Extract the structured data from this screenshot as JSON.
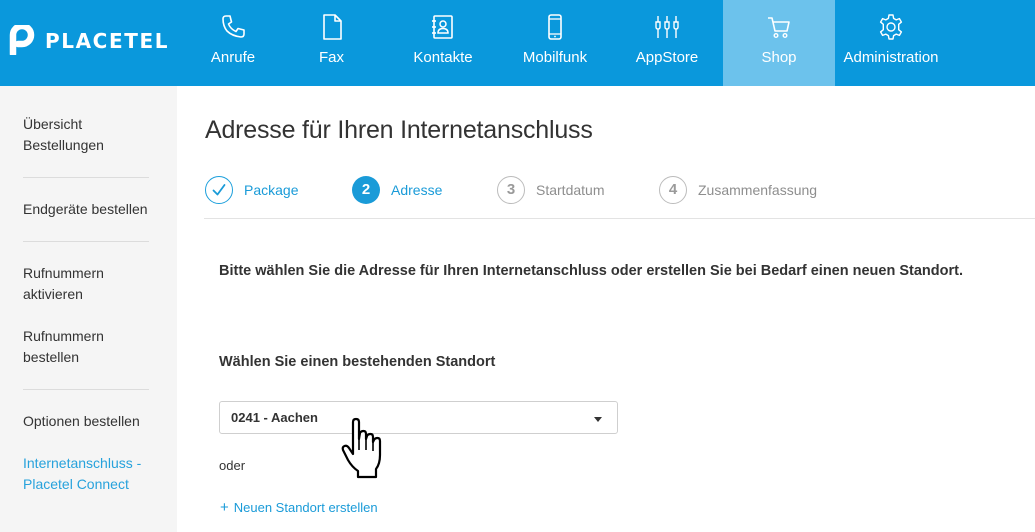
{
  "brand": {
    "name": "PLACETEL",
    "color": "#0a98dc"
  },
  "nav": {
    "items": [
      {
        "label": "Anrufe",
        "icon": "phone-icon",
        "active": false
      },
      {
        "label": "Fax",
        "icon": "document-icon",
        "active": false
      },
      {
        "label": "Kontakte",
        "icon": "address-book-icon",
        "active": false
      },
      {
        "label": "Mobilfunk",
        "icon": "mobile-phone-icon",
        "active": false
      },
      {
        "label": "AppStore",
        "icon": "plug-icon",
        "active": false
      },
      {
        "label": "Shop",
        "icon": "shopping-cart-icon",
        "active": true
      },
      {
        "label": "Administration",
        "icon": "gear-icon",
        "active": false
      }
    ]
  },
  "sidebar": {
    "items": [
      {
        "label": "Übersicht Bestellungen"
      },
      {
        "label": "Endgeräte bestellen"
      },
      {
        "label": "Rufnummern aktivieren"
      },
      {
        "label": "Rufnummern bestellen"
      },
      {
        "label": "Optionen bestellen"
      },
      {
        "label": "Internetanschluss - Placetel Connect",
        "active": true
      }
    ]
  },
  "page": {
    "title": "Adresse für Ihren Internetanschluss",
    "steps": [
      {
        "number": "1",
        "label": "Package",
        "state": "done"
      },
      {
        "number": "2",
        "label": "Adresse",
        "state": "current"
      },
      {
        "number": "3",
        "label": "Startdatum",
        "state": "future"
      },
      {
        "number": "4",
        "label": "Zusammenfassung",
        "state": "future"
      }
    ],
    "intro": "Bitte wählen Sie die Adresse für Ihren Internetanschluss oder erstellen Sie bei Bedarf einen neuen Standort.",
    "location_label": "Wählen Sie einen bestehenden Standort",
    "location_selected": "0241 - Aachen",
    "or_text": "oder",
    "new_location_plus": "+",
    "new_location_label": "Neuen Standort erstellen"
  },
  "colors": {
    "accent": "#1a9bd8",
    "active_tab": "#6cc2ec",
    "sidebar_bg": "#f5f5f5"
  }
}
